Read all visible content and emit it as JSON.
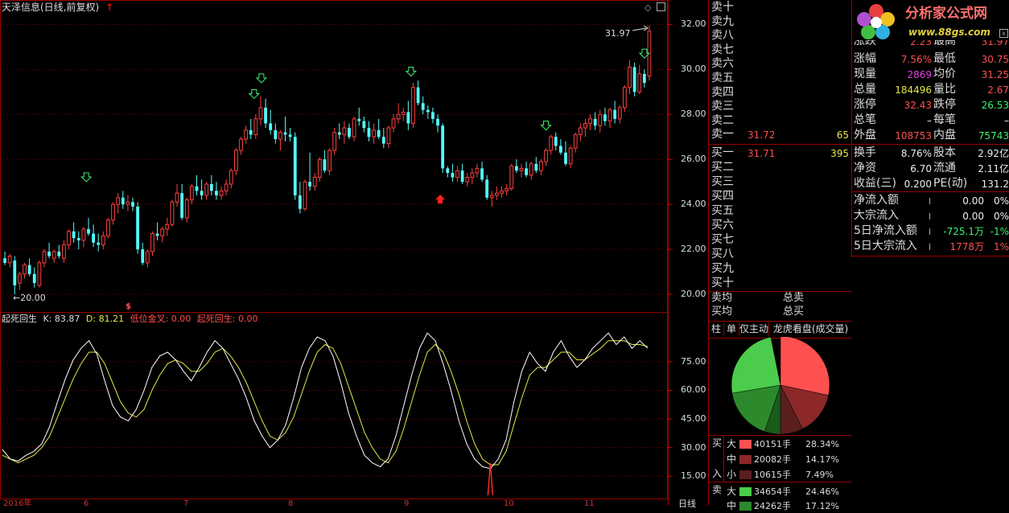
{
  "chart": {
    "title": "天泽信息(日线,前复权)",
    "high_label": "31.97",
    "low_label": "20.00",
    "price_ticks": [
      "32.00",
      "30.00",
      "28.00",
      "26.00",
      "24.00",
      "22.00",
      "20.00"
    ],
    "price_range": [
      19.5,
      32.8
    ],
    "period_label": "日线",
    "x_dates": [
      "2016年",
      "6",
      "7",
      "8",
      "9",
      "10",
      "11"
    ]
  },
  "indicator": {
    "name": "起死回生",
    "k_label": "K: 83.87",
    "d_label": "D: 81.21",
    "cross_label": "低位金叉: 0.00",
    "revive_label": "起死回生: 0.00",
    "ticks": [
      "75.00",
      "60.00",
      "45.00",
      "30.00",
      "15.00"
    ],
    "range": [
      5,
      96
    ]
  },
  "orderbook": {
    "sell": [
      {
        "label": "卖十",
        "price": "",
        "vol": ""
      },
      {
        "label": "卖九",
        "price": "",
        "vol": ""
      },
      {
        "label": "卖八",
        "price": "",
        "vol": ""
      },
      {
        "label": "卖七",
        "price": "",
        "vol": ""
      },
      {
        "label": "卖六",
        "price": "",
        "vol": ""
      },
      {
        "label": "卖五",
        "price": "",
        "vol": ""
      },
      {
        "label": "卖四",
        "price": "",
        "vol": ""
      },
      {
        "label": "卖三",
        "price": "",
        "vol": ""
      },
      {
        "label": "卖二",
        "price": "",
        "vol": ""
      },
      {
        "label": "卖一",
        "price": "31.72",
        "vol": "65"
      }
    ],
    "buy": [
      {
        "label": "买一",
        "price": "31.71",
        "vol": "395"
      },
      {
        "label": "买二",
        "price": "",
        "vol": ""
      },
      {
        "label": "买三",
        "price": "",
        "vol": ""
      },
      {
        "label": "买四",
        "price": "",
        "vol": ""
      },
      {
        "label": "买五",
        "price": "",
        "vol": ""
      },
      {
        "label": "买六",
        "price": "",
        "vol": ""
      },
      {
        "label": "买七",
        "price": "",
        "vol": ""
      },
      {
        "label": "买八",
        "price": "",
        "vol": ""
      },
      {
        "label": "买九",
        "price": "",
        "vol": ""
      },
      {
        "label": "买十",
        "price": "",
        "vol": ""
      }
    ],
    "sell_avg_label": "卖均",
    "buy_avg_label": "买均",
    "sell_total_label": "总卖",
    "buy_total_label": "总买"
  },
  "tabs": [
    "柱",
    "单",
    "仅主动",
    "龙虎看盘(成交量)涉"
  ],
  "quote": {
    "top_cut": {
      "l1": "涨跌",
      "v1": "2.23",
      "l2": "最高",
      "v2": "31.97"
    },
    "rows1": [
      {
        "l1": "涨幅",
        "v1": "7.56%",
        "l2": "最低",
        "v2": "30.75"
      },
      {
        "l1": "现量",
        "v1": "2869",
        "l2": "均价",
        "v2": "31.25"
      },
      {
        "l1": "总量",
        "v1": "184496",
        "l2": "量比",
        "v2": "2.67"
      },
      {
        "l1": "涨停",
        "v1": "32.43",
        "l2": "跌停",
        "v2": "26.53"
      },
      {
        "l1": "总笔",
        "v1": "–",
        "l2": "每笔",
        "v2": "–"
      },
      {
        "l1": "外盘",
        "v1": "108753",
        "l2": "内盘",
        "v2": "75743"
      }
    ],
    "rows2": [
      {
        "l1": "换手",
        "v1": "8.76%",
        "l2": "股本",
        "v2": "2.92亿"
      },
      {
        "l1": "净资",
        "v1": "6.70",
        "l2": "流通",
        "v2": "2.11亿"
      },
      {
        "l1": "收益(三)",
        "v1": "0.200",
        "l2": "PE(动)",
        "v2": "131.2"
      }
    ],
    "flows": [
      {
        "label": "净流入额",
        "value": "0.00",
        "pct": "0%"
      },
      {
        "label": "大宗流入",
        "value": "0.00",
        "pct": "0%"
      },
      {
        "label": "5日净流入额",
        "value": "-725.1万",
        "pct": "-1%"
      },
      {
        "label": "5日大宗流入",
        "value": "1778万",
        "pct": "1%"
      }
    ]
  },
  "logo": {
    "title": "分析家公式网",
    "url": "www.88gs.com"
  },
  "pie": {
    "slices": [
      {
        "name": "买大",
        "pct": 28.34,
        "color": "#ff5050"
      },
      {
        "name": "买中",
        "pct": 14.17,
        "color": "#8c2828"
      },
      {
        "name": "买小",
        "pct": 7.49,
        "color": "#5a1e1e"
      },
      {
        "name": "卖小",
        "pct": 5.24,
        "color": "#1a5a1a"
      },
      {
        "name": "卖中",
        "pct": 17.12,
        "color": "#2c8a2c"
      },
      {
        "name": "卖大",
        "pct": 24.46,
        "color": "#4ccc4c"
      }
    ]
  },
  "breakdown": {
    "buy_label_a": "买",
    "buy_label_b": "入",
    "sell_label": "卖",
    "rows": [
      {
        "size": "大",
        "vol": "40151手",
        "pct": "28.34%",
        "color": "#ff5050"
      },
      {
        "size": "中",
        "vol": "20082手",
        "pct": "14.17%",
        "color": "#8c2828"
      },
      {
        "size": "小",
        "vol": "10615手",
        "pct": "7.49%",
        "color": "#5a1e1e"
      },
      {
        "size": "大",
        "vol": "34654手",
        "pct": "24.46%",
        "color": "#4ccc4c"
      },
      {
        "size": "中",
        "vol": "24262手",
        "pct": "17.12%",
        "color": "#2c8a2c"
      }
    ]
  },
  "chart_data": {
    "type": "candlestick",
    "up_color": "#ff4040",
    "down_color": "#54ffff",
    "ohlc": [
      [
        21.6,
        21.9,
        21.3,
        21.4
      ],
      [
        21.4,
        21.8,
        21.2,
        21.7
      ],
      [
        21.5,
        21.7,
        20.0,
        20.4
      ],
      [
        20.5,
        21.0,
        20.2,
        20.9
      ],
      [
        20.9,
        21.4,
        20.7,
        21.3
      ],
      [
        21.3,
        21.6,
        20.8,
        20.9
      ],
      [
        20.9,
        21.2,
        20.3,
        20.5
      ],
      [
        20.4,
        21.5,
        20.3,
        21.4
      ],
      [
        21.4,
        22.0,
        21.2,
        21.9
      ],
      [
        21.9,
        22.3,
        21.6,
        21.7
      ],
      [
        21.6,
        22.0,
        21.4,
        21.9
      ],
      [
        21.9,
        22.2,
        21.6,
        21.7
      ],
      [
        21.6,
        22.4,
        21.4,
        22.2
      ],
      [
        22.2,
        22.9,
        22.0,
        22.8
      ],
      [
        22.8,
        23.2,
        22.3,
        22.5
      ],
      [
        22.5,
        22.8,
        22.0,
        22.4
      ],
      [
        22.4,
        23.0,
        22.1,
        22.9
      ],
      [
        22.9,
        23.4,
        22.6,
        22.7
      ],
      [
        22.7,
        23.1,
        22.1,
        22.3
      ],
      [
        22.3,
        22.7,
        21.9,
        22.2
      ],
      [
        22.2,
        22.8,
        22.0,
        22.6
      ],
      [
        22.6,
        23.4,
        22.5,
        23.3
      ],
      [
        23.3,
        24.1,
        23.1,
        24.0
      ],
      [
        24.0,
        24.5,
        23.6,
        24.3
      ],
      [
        24.3,
        24.6,
        23.8,
        24.0
      ],
      [
        24.0,
        24.4,
        23.7,
        24.1
      ],
      [
        24.1,
        24.3,
        23.7,
        23.9
      ],
      [
        23.9,
        24.1,
        21.8,
        22.0
      ],
      [
        22.0,
        22.3,
        21.3,
        21.4
      ],
      [
        21.4,
        22.0,
        21.2,
        21.9
      ],
      [
        21.9,
        22.8,
        21.7,
        22.7
      ],
      [
        22.7,
        23.2,
        22.4,
        22.6
      ],
      [
        22.6,
        23.0,
        22.3,
        22.9
      ],
      [
        22.9,
        23.4,
        22.6,
        23.1
      ],
      [
        23.1,
        24.2,
        23.0,
        24.1
      ],
      [
        24.1,
        24.9,
        23.9,
        24.5
      ],
      [
        24.5,
        24.9,
        23.3,
        23.4
      ],
      [
        23.4,
        24.3,
        23.2,
        24.2
      ],
      [
        24.2,
        24.9,
        24.0,
        24.8
      ],
      [
        24.8,
        25.3,
        24.4,
        24.6
      ],
      [
        24.6,
        25.1,
        24.2,
        24.4
      ],
      [
        24.4,
        25.0,
        24.2,
        24.9
      ],
      [
        24.9,
        25.3,
        24.4,
        24.6
      ],
      [
        24.6,
        25.0,
        24.2,
        24.4
      ],
      [
        24.4,
        24.8,
        24.2,
        24.6
      ],
      [
        24.6,
        25.1,
        24.4,
        24.9
      ],
      [
        24.9,
        25.6,
        24.7,
        25.5
      ],
      [
        25.5,
        26.5,
        25.3,
        26.4
      ],
      [
        26.4,
        27.0,
        26.2,
        26.9
      ],
      [
        26.9,
        27.5,
        26.7,
        27.3
      ],
      [
        27.3,
        27.8,
        26.9,
        27.1
      ],
      [
        27.1,
        28.0,
        26.9,
        27.8
      ],
      [
        27.8,
        28.8,
        27.5,
        28.3
      ],
      [
        28.3,
        28.7,
        27.4,
        27.6
      ],
      [
        27.6,
        28.2,
        27.1,
        27.3
      ],
      [
        27.3,
        27.6,
        26.7,
        26.9
      ],
      [
        26.9,
        27.3,
        26.4,
        27.2
      ],
      [
        27.2,
        27.9,
        26.8,
        27.1
      ],
      [
        27.1,
        27.4,
        26.8,
        27.0
      ],
      [
        27.0,
        27.2,
        24.2,
        24.4
      ],
      [
        24.4,
        25.0,
        23.6,
        23.8
      ],
      [
        23.8,
        25.1,
        23.7,
        25.0
      ],
      [
        25.0,
        26.3,
        24.6,
        24.8
      ],
      [
        24.8,
        25.4,
        24.6,
        25.2
      ],
      [
        25.2,
        26.1,
        25.0,
        26.0
      ],
      [
        26.0,
        26.4,
        25.4,
        25.5
      ],
      [
        25.5,
        26.5,
        25.3,
        26.4
      ],
      [
        26.4,
        27.4,
        26.2,
        27.2
      ],
      [
        27.2,
        27.6,
        26.9,
        27.1
      ],
      [
        27.1,
        27.7,
        26.7,
        27.4
      ],
      [
        27.4,
        27.6,
        26.9,
        27.0
      ],
      [
        27.0,
        27.9,
        26.8,
        27.8
      ],
      [
        27.8,
        28.3,
        27.5,
        27.7
      ],
      [
        27.7,
        27.9,
        27.2,
        27.4
      ],
      [
        27.4,
        27.7,
        26.8,
        27.0
      ],
      [
        27.0,
        27.6,
        26.7,
        27.3
      ],
      [
        27.3,
        27.8,
        26.9,
        27.0
      ],
      [
        27.0,
        27.4,
        26.5,
        26.7
      ],
      [
        26.7,
        27.5,
        26.5,
        27.4
      ],
      [
        27.4,
        28.0,
        27.2,
        27.8
      ],
      [
        27.8,
        28.5,
        27.6,
        28.0
      ],
      [
        28.0,
        28.3,
        27.7,
        28.1
      ],
      [
        28.1,
        28.6,
        27.3,
        27.6
      ],
      [
        27.6,
        29.4,
        27.4,
        29.2
      ],
      [
        29.2,
        29.5,
        28.4,
        28.5
      ],
      [
        28.5,
        28.8,
        28.0,
        28.2
      ],
      [
        28.2,
        28.4,
        27.8,
        28.1
      ],
      [
        28.1,
        28.3,
        27.6,
        27.8
      ],
      [
        27.8,
        28.0,
        27.2,
        27.5
      ],
      [
        27.5,
        27.6,
        25.4,
        25.6
      ],
      [
        25.6,
        25.7,
        25.2,
        25.4
      ],
      [
        25.4,
        25.8,
        25.0,
        25.2
      ],
      [
        25.2,
        25.7,
        25.0,
        25.5
      ],
      [
        25.5,
        25.8,
        24.9,
        25.0
      ],
      [
        25.0,
        25.4,
        24.8,
        25.2
      ],
      [
        25.2,
        25.6,
        24.9,
        25.4
      ],
      [
        25.4,
        25.8,
        25.2,
        25.6
      ],
      [
        25.6,
        25.9,
        25.0,
        25.1
      ],
      [
        25.1,
        25.3,
        24.2,
        24.3
      ],
      [
        24.3,
        24.6,
        23.9,
        24.4
      ],
      [
        24.4,
        24.8,
        24.2,
        24.5
      ],
      [
        24.5,
        24.8,
        24.3,
        24.6
      ],
      [
        24.6,
        24.9,
        24.4,
        24.7
      ],
      [
        24.7,
        25.8,
        24.6,
        25.7
      ],
      [
        25.7,
        26.0,
        25.4,
        25.5
      ],
      [
        25.5,
        25.8,
        25.2,
        25.6
      ],
      [
        25.6,
        25.9,
        25.2,
        25.3
      ],
      [
        25.3,
        25.9,
        25.1,
        25.8
      ],
      [
        25.8,
        26.1,
        25.4,
        25.5
      ],
      [
        25.5,
        26.0,
        25.3,
        25.9
      ],
      [
        25.9,
        26.5,
        25.7,
        26.4
      ],
      [
        26.4,
        27.1,
        26.2,
        27.0
      ],
      [
        27.0,
        27.2,
        26.4,
        26.6
      ],
      [
        26.6,
        26.9,
        26.2,
        26.3
      ],
      [
        26.3,
        26.8,
        25.7,
        25.8
      ],
      [
        25.8,
        26.6,
        25.6,
        26.5
      ],
      [
        26.5,
        27.2,
        26.3,
        27.1
      ],
      [
        27.1,
        27.6,
        26.8,
        27.4
      ],
      [
        27.4,
        27.8,
        27.0,
        27.6
      ],
      [
        27.6,
        28.0,
        27.3,
        27.8
      ],
      [
        27.8,
        28.1,
        27.3,
        27.5
      ],
      [
        27.5,
        28.2,
        27.2,
        28.0
      ],
      [
        28.0,
        28.3,
        27.5,
        27.7
      ],
      [
        27.7,
        28.3,
        27.4,
        28.2
      ],
      [
        28.2,
        28.6,
        27.6,
        27.8
      ],
      [
        27.8,
        28.4,
        27.6,
        28.3
      ],
      [
        28.3,
        29.3,
        28.1,
        29.2
      ],
      [
        29.2,
        30.4,
        28.9,
        30.1
      ],
      [
        30.1,
        30.3,
        28.8,
        29.0
      ],
      [
        29.0,
        30.2,
        28.9,
        29.8
      ],
      [
        29.8,
        30.0,
        29.2,
        29.4
      ],
      [
        29.7,
        31.97,
        29.5,
        31.7
      ]
    ],
    "kd": {
      "k": [
        29,
        24,
        23,
        26,
        28,
        32,
        41,
        54,
        66,
        76,
        82,
        86,
        79,
        65,
        52,
        46,
        44,
        50,
        60,
        72,
        78,
        80,
        76,
        70,
        65,
        72,
        80,
        86,
        82,
        74,
        66,
        56,
        44,
        36,
        30,
        34,
        42,
        56,
        72,
        82,
        88,
        86,
        78,
        64,
        48,
        36,
        26,
        22,
        20,
        24,
        36,
        52,
        68,
        82,
        90,
        86,
        74,
        60,
        44,
        32,
        24,
        20,
        19,
        24,
        34,
        54,
        70,
        80,
        74,
        70,
        80,
        86,
        78,
        72,
        76,
        82,
        86,
        90,
        84,
        88,
        82,
        86,
        82
      ],
      "d": [
        26,
        24,
        22,
        24,
        26,
        30,
        36,
        46,
        56,
        66,
        74,
        80,
        80,
        74,
        64,
        54,
        48,
        46,
        50,
        60,
        68,
        74,
        76,
        74,
        70,
        70,
        74,
        80,
        82,
        78,
        72,
        64,
        54,
        44,
        36,
        34,
        38,
        46,
        58,
        70,
        80,
        84,
        82,
        74,
        62,
        50,
        38,
        30,
        24,
        22,
        28,
        40,
        54,
        68,
        80,
        84,
        80,
        70,
        58,
        44,
        32,
        24,
        21,
        21,
        28,
        42,
        56,
        68,
        72,
        72,
        76,
        80,
        80,
        76,
        76,
        79,
        82,
        86,
        86,
        86,
        84,
        84,
        83
      ],
      "signal": [
        0,
        0,
        0,
        0,
        0,
        0,
        0,
        0,
        0,
        0,
        0,
        0,
        0,
        0,
        0,
        0,
        0,
        0,
        0,
        0,
        0,
        0,
        0,
        0,
        0,
        0,
        0,
        0,
        0,
        0,
        0,
        0,
        0,
        0,
        0,
        0,
        0,
        0,
        0,
        0,
        0,
        0,
        0,
        0,
        0,
        0,
        0,
        0,
        0,
        0,
        0,
        0,
        0,
        0,
        0,
        0,
        0,
        0,
        0,
        0,
        0,
        0,
        40,
        0,
        0,
        0,
        0,
        0,
        0,
        0,
        0,
        0,
        0,
        0,
        0,
        0,
        0,
        0,
        0,
        0,
        0,
        0,
        0
      ]
    },
    "markers": {
      "green_down_arrows": [
        [
          23,
          24.9
        ],
        [
          69,
          28.6
        ],
        [
          71,
          29.3
        ],
        [
          112,
          29.6
        ],
        [
          149,
          27.2
        ],
        [
          176,
          30.4
        ]
      ],
      "red_up_arrow": [
        [
          120,
          24.5
        ]
      ]
    }
  }
}
